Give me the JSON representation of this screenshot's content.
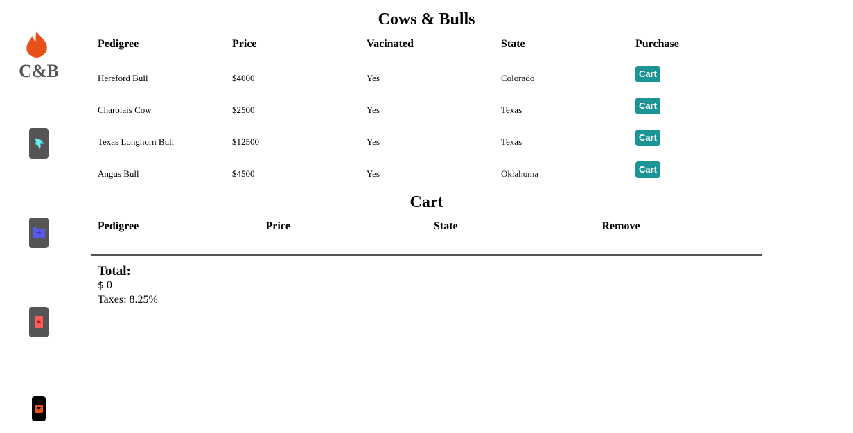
{
  "brand": {
    "logo_text": "C&B",
    "accent_color": "#e8501a"
  },
  "sidebar": {
    "buttons": [
      {
        "icon": "dolphin-icon",
        "color": "#5ff0f0"
      },
      {
        "icon": "folder-icon",
        "color": "#5a5ae8"
      },
      {
        "icon": "card-icon",
        "color": "#ff5a5a"
      },
      {
        "icon": "down-arrow-icon",
        "color": "#e8501a"
      }
    ]
  },
  "listing": {
    "title": "Cows & Bulls",
    "headers": [
      "Pedigree",
      "Price",
      "Vacinated",
      "State",
      "Purchase"
    ],
    "rows": [
      {
        "pedigree": "Hereford Bull",
        "price": "$4000",
        "vaccinated": "Yes",
        "state": "Colorado",
        "action": "Cart"
      },
      {
        "pedigree": "Charolais Cow",
        "price": "$2500",
        "vaccinated": "Yes",
        "state": "Texas",
        "action": "Cart"
      },
      {
        "pedigree": "Texas Longhorn Bull",
        "price": "$12500",
        "vaccinated": "Yes",
        "state": "Texas",
        "action": "Cart"
      },
      {
        "pedigree": "Angus Bull",
        "price": "$4500",
        "vaccinated": "Yes",
        "state": "Oklahoma",
        "action": "Cart"
      }
    ],
    "button_color": "#1a9494"
  },
  "cart": {
    "title": "Cart",
    "headers": [
      "Pedigree",
      "Price",
      "State",
      "Remove"
    ],
    "total_label": "Total:",
    "currency_symbol": "$",
    "total_value": "0",
    "taxes": "Taxes: 8.25%"
  }
}
